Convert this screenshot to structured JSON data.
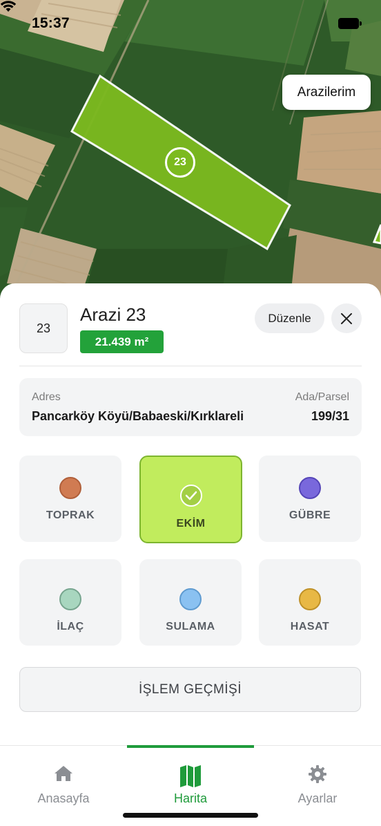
{
  "status_bar": {
    "time": "15:37"
  },
  "map": {
    "my_lands_button": "Arazilerim",
    "field_marker_label": "23",
    "field_color": "#7cba1f"
  },
  "field": {
    "number": "23",
    "title": "Arazi 23",
    "area": "21.439 m²",
    "edit_label": "Düzenle",
    "address_label": "Adres",
    "address_value": "Pancarköy Köyü/Babaeski/Kırklareli",
    "parcel_label": "Ada/Parsel",
    "parcel_value": "199/31"
  },
  "operations": [
    {
      "label": "TOPRAK",
      "color": "#d07b52",
      "selected": false
    },
    {
      "label": "EKİM",
      "color": "#a3cf45",
      "selected": true
    },
    {
      "label": "GÜBRE",
      "color": "#7968dc",
      "selected": false
    },
    {
      "label": "İLAÇ",
      "color": "#a8d6bf",
      "selected": false
    },
    {
      "label": "SULAMA",
      "color": "#8ac1f1",
      "selected": false
    },
    {
      "label": "HASAT",
      "color": "#e8b845",
      "selected": false
    }
  ],
  "history_button": "İŞLEM GEÇMİŞİ",
  "tabs": [
    {
      "label": "Anasayfa",
      "icon": "home-icon",
      "active": false
    },
    {
      "label": "Harita",
      "icon": "map-icon",
      "active": true
    },
    {
      "label": "Ayarlar",
      "icon": "gear-icon",
      "active": false
    }
  ],
  "colors": {
    "accent": "#1f9b3b",
    "selected_card": "#c1ec5d"
  }
}
